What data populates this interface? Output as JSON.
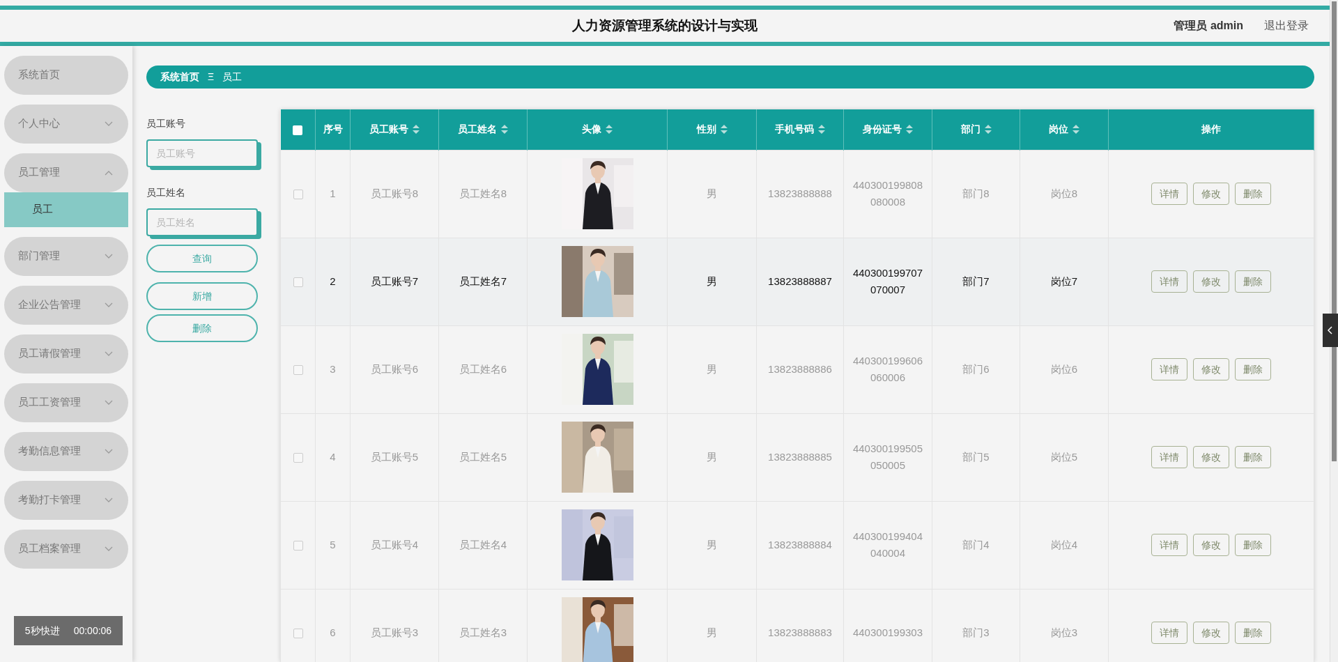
{
  "header": {
    "title": "人力资源管理系统的设计与实现",
    "user": "管理员 admin",
    "logout": "退出登录"
  },
  "sidebar": {
    "items": [
      {
        "label": "系统首页"
      },
      {
        "label": "个人中心",
        "expanded": false
      },
      {
        "label": "员工管理",
        "expanded": true,
        "children": [
          {
            "label": "员工",
            "selected": true
          }
        ]
      },
      {
        "label": "部门管理",
        "expanded": false
      },
      {
        "label": "企业公告管理",
        "expanded": false
      },
      {
        "label": "员工请假管理",
        "expanded": false
      },
      {
        "label": "员工工资管理",
        "expanded": false
      },
      {
        "label": "考勤信息管理",
        "expanded": false
      },
      {
        "label": "考勤打卡管理",
        "expanded": false
      },
      {
        "label": "员工档案管理",
        "expanded": false
      }
    ]
  },
  "recorder": {
    "label": "5秒快进",
    "time": "00:00:06"
  },
  "breadcrumb": {
    "home": "系统首页",
    "separator": "Ξ",
    "current": "员工"
  },
  "search": {
    "fields": [
      {
        "label": "员工账号",
        "placeholder": "员工账号"
      },
      {
        "label": "员工姓名",
        "placeholder": "员工姓名"
      }
    ],
    "buttons": [
      "查询",
      "新增",
      "删除"
    ]
  },
  "table": {
    "select_all": {
      "checked": false
    },
    "columns": [
      {
        "label": "序号",
        "sortable": false
      },
      {
        "label": "员工账号",
        "sortable": true
      },
      {
        "label": "员工姓名",
        "sortable": true
      },
      {
        "label": "头像",
        "sortable": true
      },
      {
        "label": "性别",
        "sortable": true
      },
      {
        "label": "手机号码",
        "sortable": true
      },
      {
        "label": "身份证号",
        "sortable": true
      },
      {
        "label": "部门",
        "sortable": true
      },
      {
        "label": "岗位",
        "sortable": true
      },
      {
        "label": "操作",
        "sortable": false
      }
    ],
    "rows": [
      {
        "checked": false,
        "highlighted": false,
        "cells": [
          "1",
          "员工账号8",
          "员工姓名8"
        ],
        "avatar": {
          "kind": "picture"
        },
        "cells2": [
          "男",
          "13823888888",
          "440300199808080008",
          "部门8",
          "岗位8"
        ],
        "actions": [
          "详情",
          "修改",
          "删除"
        ]
      },
      {
        "checked": false,
        "highlighted": true,
        "cells": [
          "2",
          "员工账号7",
          "员工姓名7"
        ],
        "avatar": {
          "kind": "picture"
        },
        "cells2": [
          "男",
          "13823888887",
          "440300199707070007",
          "部门7",
          "岗位7"
        ],
        "actions": [
          "详情",
          "修改",
          "删除"
        ]
      },
      {
        "checked": false,
        "highlighted": false,
        "cells": [
          "3",
          "员工账号6",
          "员工姓名6"
        ],
        "avatar": {
          "kind": "picture"
        },
        "cells2": [
          "男",
          "13823888886",
          "440300199606060006",
          "部门6",
          "岗位6"
        ],
        "actions": [
          "详情",
          "修改",
          "删除"
        ]
      },
      {
        "checked": false,
        "highlighted": false,
        "cells": [
          "4",
          "员工账号5",
          "员工姓名5"
        ],
        "avatar": {
          "kind": "picture"
        },
        "cells2": [
          "男",
          "13823888885",
          "440300199505050005",
          "部门5",
          "岗位5"
        ],
        "actions": [
          "详情",
          "修改",
          "删除"
        ]
      },
      {
        "checked": false,
        "highlighted": false,
        "cells": [
          "5",
          "员工账号4",
          "员工姓名4"
        ],
        "avatar": {
          "kind": "picture"
        },
        "cells2": [
          "男",
          "13823888884",
          "440300199404040004",
          "部门4",
          "岗位4"
        ],
        "actions": [
          "详情",
          "修改",
          "删除"
        ]
      },
      {
        "checked": false,
        "highlighted": false,
        "cells": [
          "6",
          "员工账号3",
          "员工姓名3"
        ],
        "avatar": {
          "kind": "picture"
        },
        "cells2": [
          "男",
          "13823888883",
          "440300199303",
          "部门3",
          "岗位3"
        ],
        "actions": [
          "详情",
          "修改",
          "删除"
        ]
      }
    ]
  }
}
